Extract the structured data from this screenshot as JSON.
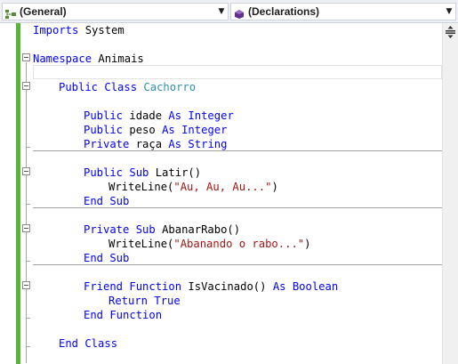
{
  "toolbar": {
    "left_combo": {
      "label": "(General)",
      "icon": "class-icon"
    },
    "right_combo": {
      "label": "(Declarations)",
      "icon": "method-icon"
    }
  },
  "colors": {
    "keyword": "#0000ff",
    "type": "#2b91af",
    "string": "#a31515",
    "change_bar": "#57b53a"
  },
  "code": {
    "l1": [
      "Imports",
      " System"
    ],
    "l3": [
      "Namespace",
      " Animais"
    ],
    "l5": [
      "Public Class",
      "Cachorro"
    ],
    "l7": [
      "Public",
      "idade",
      "As Integer"
    ],
    "l8": [
      "Public",
      "peso",
      "As Integer"
    ],
    "l9": [
      "Private",
      "raça",
      "As String"
    ],
    "l11": [
      "Public Sub",
      "Latir()"
    ],
    "l12": [
      "WriteLine(",
      "\"Au, Au, Au...\"",
      ")"
    ],
    "l13": [
      "End Sub"
    ],
    "l15": [
      "Private Sub",
      "AbanarRabo()"
    ],
    "l16": [
      "WriteLine(",
      "\"Abanando o rabo...\"",
      ")"
    ],
    "l17": [
      "End Sub"
    ],
    "l19": [
      "Friend Function",
      "IsVacinado()",
      "As Boolean"
    ],
    "l20": [
      "Return True"
    ],
    "l21": [
      "End Function"
    ],
    "l23": [
      "End Class"
    ]
  }
}
